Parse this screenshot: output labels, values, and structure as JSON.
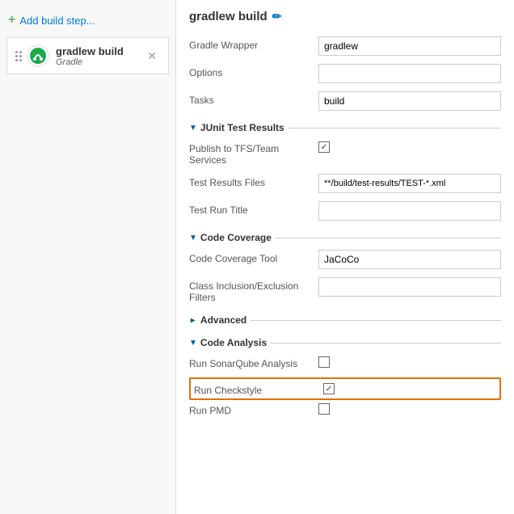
{
  "leftPanel": {
    "addBuildStep": {
      "label": "Add build step...",
      "plusIcon": "+"
    },
    "buildItems": [
      {
        "name": "gradlew build",
        "type": "Gradle",
        "showClose": true
      }
    ]
  },
  "rightPanel": {
    "title": "gradlew build",
    "editIconLabel": "✏",
    "fields": {
      "gradleWrapper": {
        "label": "Gradle Wrapper",
        "value": "gradlew"
      },
      "options": {
        "label": "Options",
        "value": ""
      },
      "tasks": {
        "label": "Tasks",
        "value": "build"
      }
    },
    "sections": {
      "junitTestResults": {
        "label": "JUnit Test Results",
        "collapsed": false,
        "fields": {
          "publishToTFS": {
            "label": "Publish to TFS/Team Services",
            "checked": true
          },
          "testResultsFiles": {
            "label": "Test Results Files",
            "value": "**/build/test-results/TEST-*.xml"
          },
          "testRunTitle": {
            "label": "Test Run Title",
            "value": ""
          }
        }
      },
      "codeCoverage": {
        "label": "Code Coverage",
        "collapsed": false,
        "fields": {
          "codeCoverageTool": {
            "label": "Code Coverage Tool",
            "value": "JaCoCo"
          },
          "classInclusionExclusionFilters": {
            "label": "Class Inclusion/Exclusion Filters",
            "value": ""
          }
        }
      },
      "advanced": {
        "label": "Advanced",
        "collapsed": true
      },
      "codeAnalysis": {
        "label": "Code Analysis",
        "collapsed": false,
        "fields": {
          "runSonarQubeAnalysis": {
            "label": "Run SonarQube Analysis",
            "checked": false
          },
          "runCheckstyle": {
            "label": "Run Checkstyle",
            "checked": true,
            "highlighted": true
          },
          "runPMD": {
            "label": "Run PMD",
            "checked": false
          }
        }
      }
    }
  }
}
